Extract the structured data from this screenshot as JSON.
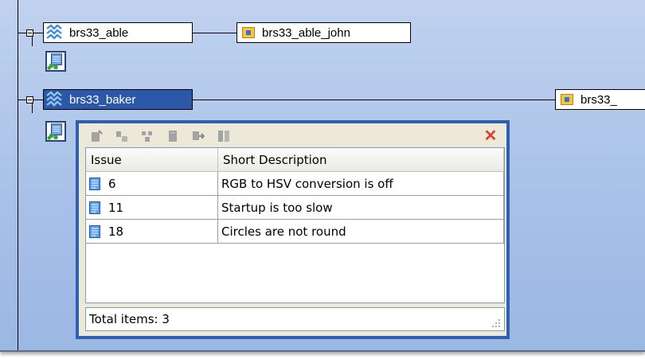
{
  "nodes": {
    "able": {
      "label": "brs33_able",
      "icon": "stream-icon"
    },
    "able_john": {
      "label": "brs33_able_john",
      "icon": "workspace-icon"
    },
    "baker": {
      "label": "brs33_baker",
      "icon": "stream-icon",
      "selected": true
    },
    "baker_child": {
      "label": "brs33_",
      "icon": "workspace-icon"
    }
  },
  "popup": {
    "toolbar_icons": [
      "new-issue-icon",
      "associate-issue-icon",
      "add-issues-icon",
      "edit-issue-icon",
      "move-issue-icon",
      "split-issue-icon"
    ],
    "close_icon": "close-icon",
    "columns": [
      "Issue",
      "Short Description"
    ],
    "rows": [
      {
        "issue": "6",
        "description": "RGB to HSV conversion is off"
      },
      {
        "issue": "11",
        "description": "Startup is too slow"
      },
      {
        "issue": "18",
        "description": "Circles are not round"
      }
    ],
    "status": "Total items: 3"
  },
  "colors": {
    "background": "#b1c7ea",
    "selection": "#2b58a8",
    "popup_border": "#2e5fb2",
    "close": "#d94030"
  }
}
